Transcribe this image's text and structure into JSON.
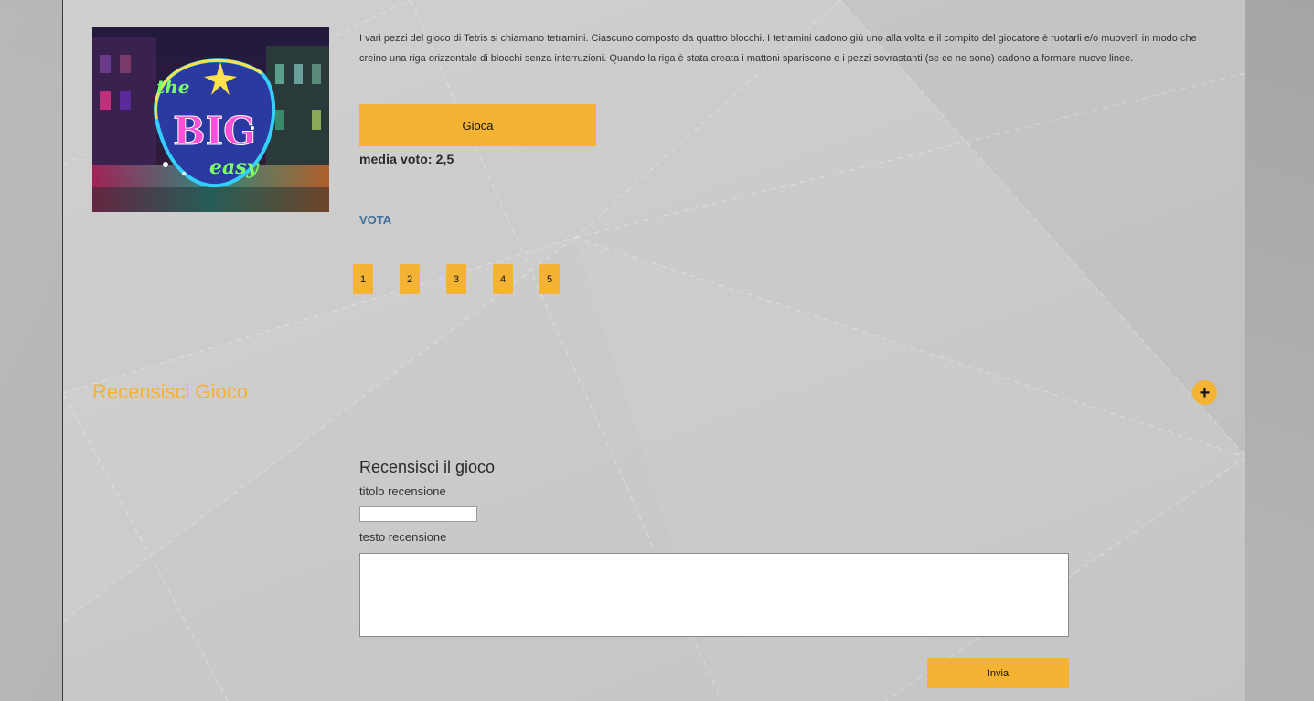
{
  "game": {
    "logo_text": "the BIG easy",
    "description": "I vari pezzi del gioco di Tetris si chiamano tetramini. Ciascuno composto da quattro blocchi. I tetramini cadono giù uno alla volta e il compito del giocatore è ruotarli e/o muoverli in modo che creino una riga orizzontale di blocchi senza interruzioni. Quando la riga è stata creata i mattoni spariscono e i pezzi sovrastanti (se ce ne sono) cadono a formare nuove linee.",
    "play_label": "Gioca",
    "avg_rating": "media voto: 2,5"
  },
  "vote": {
    "label": "VOTA",
    "options": [
      "1",
      "2",
      "3",
      "4",
      "5"
    ]
  },
  "review_section": {
    "header_title": "Recensisci Gioco",
    "expand_label": "+",
    "form_title": "Recensisci il gioco",
    "title_label": "titolo recensione",
    "title_value": "",
    "text_label": "testo recensione",
    "text_value": "",
    "submit_label": "Invia"
  },
  "colors": {
    "accent": "#f5b333",
    "link": "#3f6f9a",
    "divider": "#4a2a5a",
    "background": "#c9c9c9"
  }
}
